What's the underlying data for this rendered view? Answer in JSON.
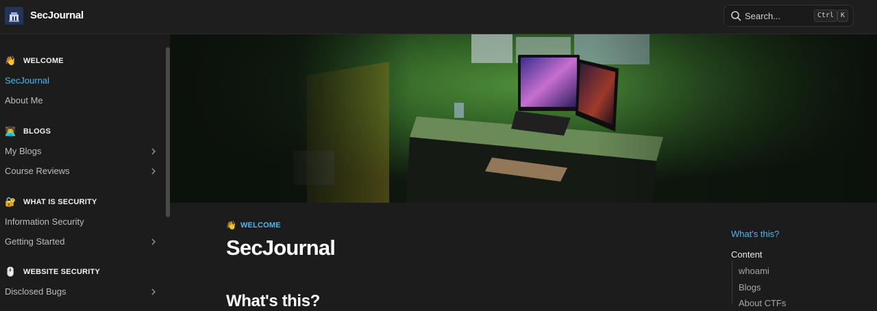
{
  "header": {
    "site_title": "SecJournal",
    "search_label": "Search...",
    "shortcut_ctrl": "Ctrl",
    "shortcut_key": "K"
  },
  "sidebar": {
    "sections": [
      {
        "emoji": "👋",
        "label": "WELCOME"
      },
      {
        "emoji": "👨‍💻",
        "label": "BLOGS"
      },
      {
        "emoji": "🔐",
        "label": "WHAT IS SECURITY"
      },
      {
        "emoji": "🖱️",
        "label": "WEBSITE SECURITY"
      }
    ],
    "items": [
      {
        "label": "SecJournal",
        "active": true
      },
      {
        "label": "About Me"
      },
      {
        "label": "My Blogs"
      },
      {
        "label": "Course Reviews"
      },
      {
        "label": "Information Security"
      },
      {
        "label": "Getting Started"
      },
      {
        "label": "Disclosed Bugs"
      }
    ]
  },
  "main": {
    "breadcrumb_emoji": "👋",
    "breadcrumb_label": "WELCOME",
    "title": "SecJournal",
    "heading": "What's this?"
  },
  "toc": {
    "link": "What's this?",
    "heading": "Content",
    "items": [
      "whoami",
      "Blogs",
      "About CTFs"
    ]
  },
  "colors": {
    "accent": "#4fb8ec",
    "background": "#1c1c1c",
    "hero_wall": "#3f7a30"
  }
}
